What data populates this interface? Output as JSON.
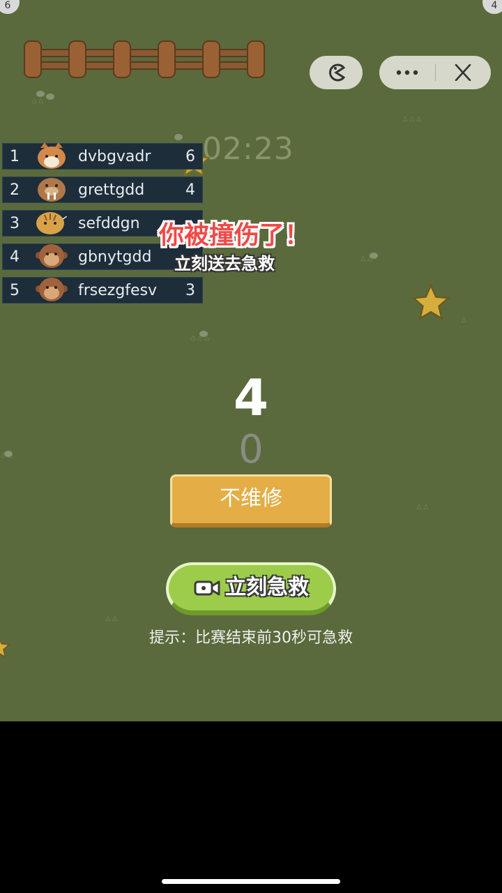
{
  "corner_badges": {
    "left": "6",
    "right": "4"
  },
  "timer": "02:23",
  "leaderboard": [
    {
      "rank": "1",
      "name": "dvbgvadr",
      "score": "6",
      "avatar": "cat-icon",
      "color": "#d4894a"
    },
    {
      "rank": "2",
      "name": "grettgdd",
      "score": "4",
      "avatar": "walrus-icon",
      "color": "#b07748"
    },
    {
      "rank": "3",
      "name": "sefddgn",
      "score": "",
      "avatar": "tiger-icon",
      "color": "#d9a248"
    },
    {
      "rank": "4",
      "name": "gbnytgdd",
      "score": "",
      "avatar": "monkey-icon",
      "color": "#a0623a"
    },
    {
      "rank": "5",
      "name": "frsezgfesv",
      "score": "3",
      "avatar": "monkey-icon",
      "color": "#a0623a"
    }
  ],
  "banner": {
    "title": "你被撞伤了！",
    "subtitle": "立刻送去急救"
  },
  "countdown": {
    "current": "4",
    "next": "0"
  },
  "buttons": {
    "no_repair": "不维修",
    "rescue_now": "立刻急救"
  },
  "hint": "提示：比赛结束前30秒可急救",
  "menu_icons": [
    "pacman-icon",
    "more-icon",
    "close-icon"
  ]
}
